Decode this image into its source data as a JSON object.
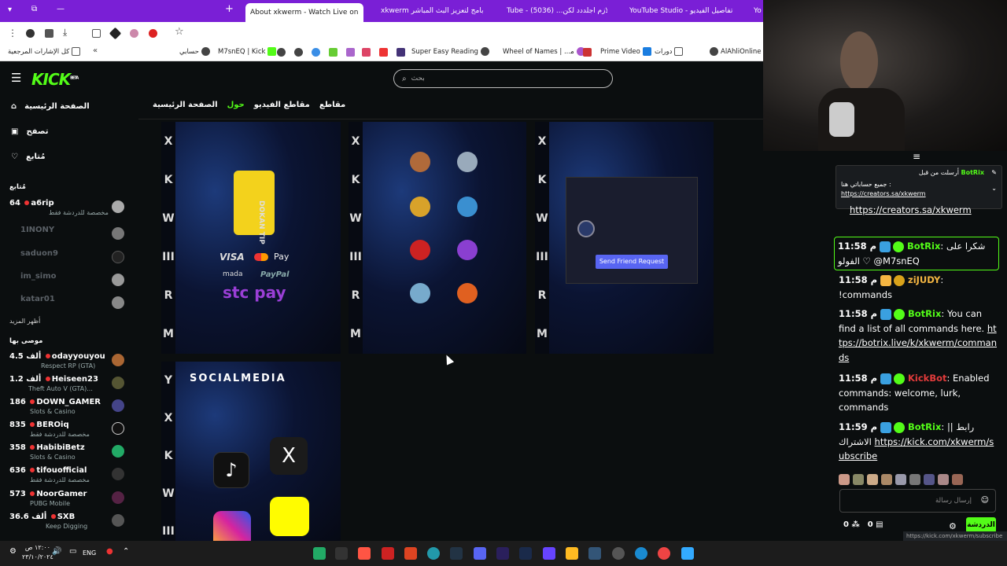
{
  "browser": {
    "tabs": [
      {
        "label": "About xkwerm - Watch Live on"
      },
      {
        "label": "xkwerm ﺑﺎﻣﺞ ﻟﺘﻌﺰﻳﺰ اﻟﺒﺚ اﻟﻤﺒﺎﺷﺮ"
      },
      {
        "label": "Tube - ﻻﺯﻡ ﺍﺟﻠﺪﺩﺩ ﻟﻜﻦ... (5036)"
      },
      {
        "label": "YouTube Studio - ﺗﻔﺎﺻﻴﻞ ﺍﻟﻔﻴﺪﻳﻮ"
      },
      {
        "label": "Yo"
      }
    ],
    "bookmarks": [
      {
        "label": "ﻛﻞ ﺍﻹﺷﺎﺭﺍﺕ ﺍﻟﻤﺮﺟﻌﻴﺔ"
      },
      {
        "label": "ﺣﺴﺎﺑﻲ"
      },
      {
        "label": "M7snEQ | Kick"
      },
      {
        "label": "Super Easy Reading"
      },
      {
        "label": "Wheel of Names | ...ﻣ"
      },
      {
        "label": "Prime Video"
      },
      {
        "label": "ﺩﻭﺭﺍﺕ"
      },
      {
        "label": "AlAhliOnline"
      }
    ]
  },
  "site": {
    "logo": "KICK",
    "logo_badge": "BETA",
    "search_placeholder": "ﺑﺤﺚ"
  },
  "sidebar": {
    "nav": [
      {
        "label": "ﺍﻟﺼﻔﺤﺔ ﺍﻟﺮﺋﻴﺴﻴﺔ",
        "icon": "home-icon"
      },
      {
        "label": "ﺗﺼﻔﺢ",
        "icon": "browse-icon"
      },
      {
        "label": "ﻣُﺘﺎﺑﻊ",
        "icon": "heart-icon"
      }
    ],
    "following_title": "ﻣُﺘﺎﺑﻊ",
    "following": [
      {
        "count": "64",
        "name": "a6rip",
        "cat": "ﻣﺨﺼﺼﺔ ﻟﻠﺪﺭﺩﺷﺔ ﻓﻘﻂ",
        "live": true
      },
      {
        "name": "1INONY",
        "live": false
      },
      {
        "name": "saduon9",
        "live": false
      },
      {
        "name": "im_simo",
        "live": false
      },
      {
        "name": "katar01",
        "live": false
      }
    ],
    "show_more": "ﺃﻇﻬﺮ ﺍﻟﻤﺰﻳﺪ",
    "recommended_title": "ﻣﻮﺻﻰ ﺑﻬﺎ",
    "recommended": [
      {
        "count": "4.5 ﺃﻟﻒ",
        "name": "odayyouyou",
        "cat": "Respect RP (GTA)"
      },
      {
        "count": "1.2 ﺃﻟﻒ",
        "name": "Heiseen23",
        "cat": "Theft Auto V (GTA)..."
      },
      {
        "count": "186",
        "name": "DOWN_GAMER",
        "cat": "Slots & Casino"
      },
      {
        "count": "835",
        "name": "BEROiq",
        "cat": "ﻣﺨﺼﺼﺔ ﻟﻠﺪﺭﺩﺷﺔ ﻓﻘﻂ"
      },
      {
        "count": "358",
        "name": "HabibiBetz",
        "cat": "Slots & Casino"
      },
      {
        "count": "636",
        "name": "tifouofficial",
        "cat": "ﻣﺨﺼﺼﺔ ﻟﻠﺪﺭﺩﺷﺔ ﻓﻘﻂ"
      },
      {
        "count": "573",
        "name": "NoorGamer",
        "cat": "PUBG Mobile"
      },
      {
        "count": "36.6 ﺃﻟﻒ",
        "name": "SXB",
        "cat": "Keep Digging"
      }
    ]
  },
  "main": {
    "tabs": [
      "ﻣﻘﺎﻃﻊ",
      "ﻣﻘﺎﻃﻊ ﺍﻟﻔﻴﺪﻳﻮ",
      "ﺣﻮﻝ",
      "ﺍﻟﺼﻔﺤﺔ ﺍﻟﺮﺋﻴﺴﻴﺔ"
    ],
    "active_tab": "ﺣﻮﻝ",
    "panel1": {
      "brand": "DOKAN TIP",
      "pay": [
        "VISA",
        "Pay",
        "mada",
        "PayPal",
        "stc pay"
      ]
    },
    "panel3": {
      "button": "Send Friend Request"
    },
    "panel4": {
      "title": "SOCIALMEDIA"
    },
    "band_letters": [
      "X",
      "K",
      "W",
      "E",
      "R",
      "M"
    ]
  },
  "chat": {
    "pinned": {
      "user": "BotRix",
      "sent_by": "ﺃﺭﺳﻠﺖ ﻣﻦ ﻗﺒﻞ",
      "text": "ﺟﻤﻴﻊ ﺣﺴﺎﺑﺎﺗﻲ ﻫﻨﺎ :",
      "link": "https://creators.sa/xkwerm"
    },
    "partial": "https://creators.sa/xkwerm",
    "messages": [
      {
        "time": "11:58 م",
        "user": "BotRix",
        "text": "ﺷﻜﺮﺍ ﻋﻠﻰ ﺍﻟﻔﻮﻟﻮ ♡ @M7snEQ",
        "color": "#53fc18"
      },
      {
        "time": "11:58 م",
        "user": "ziJUDY",
        "text": "!commands",
        "color": "#f5b642"
      },
      {
        "time": "11:58 م",
        "user": "BotRix",
        "text": "You can find a list of all commands here.",
        "link": "https://botrix.live/k/xkwerm/commands",
        "color": "#53fc18"
      },
      {
        "time": "11:58 م",
        "user": "KickBot",
        "text": "Enabled commands: welcome, lurk, commands",
        "color": "#e23b3b"
      },
      {
        "time": "11:59 م",
        "user": "BotRix",
        "text": "|| ﺭﺍﺑﻂ ﺍﻻﺷﺘﺮﺍﻙ",
        "link": "https://kick.com/xkwerm/subscribe",
        "color": "#53fc18"
      }
    ],
    "input_placeholder": "ﺇﺭﺳﺎﻝ ﺭﺳﺎﻟﺔ",
    "send_label": "ﺍﻟﺪﺭﺩﺷﺔ",
    "count_a": "0",
    "count_b": "0",
    "status_url": "https://kick.com/xkwerm/subscribe"
  },
  "taskbar": {
    "lang": "ENG",
    "time": "١٢:٠٠ ص",
    "date": "٢٣/١٠/٢٠٢٤"
  },
  "colors": {
    "accent": "#53fc18",
    "tab_purple": "#7a1fd6"
  }
}
